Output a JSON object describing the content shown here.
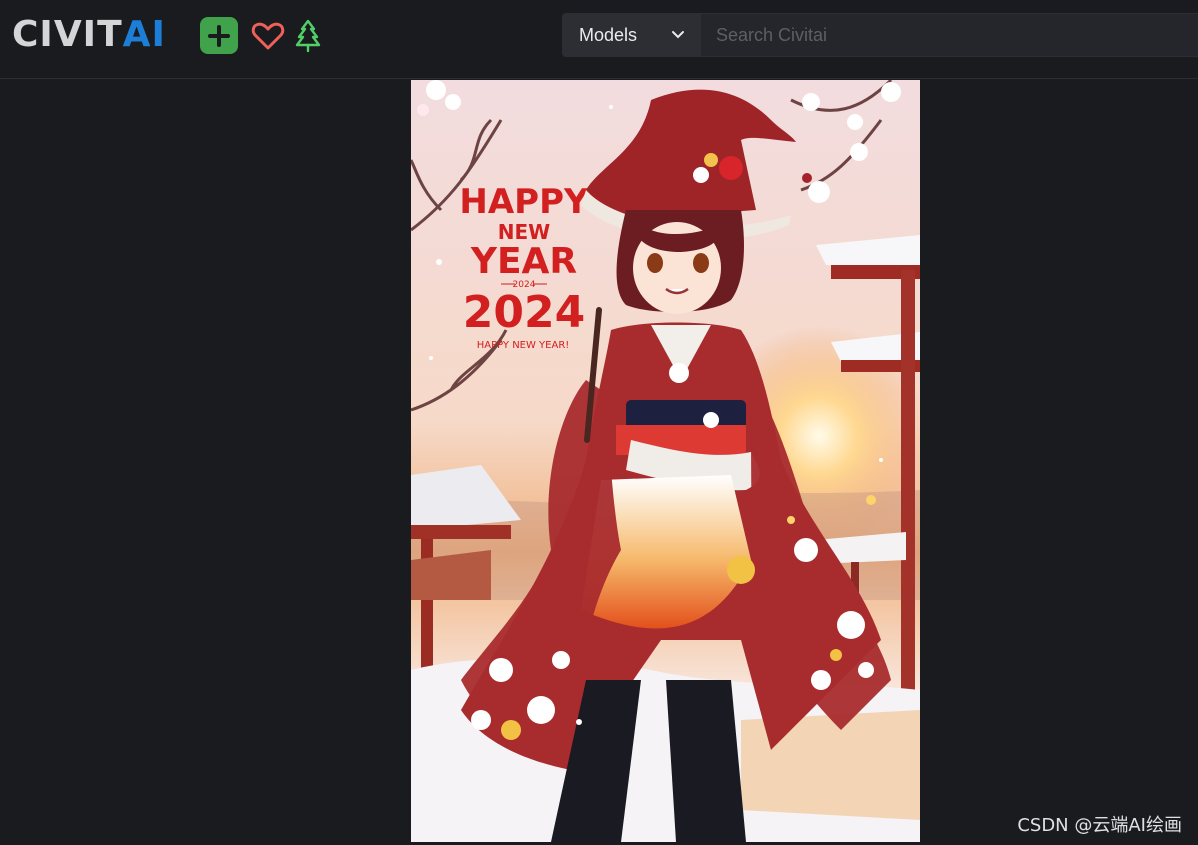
{
  "header": {
    "logo": {
      "part1": "CIVIT",
      "part2": "AI"
    },
    "create_button": "create",
    "icons": [
      "plus-icon",
      "heart-icon",
      "christmas-tree-icon"
    ],
    "search": {
      "type_select": "Models",
      "placeholder": "Search Civitai"
    }
  },
  "image": {
    "poster_lines": [
      "HAPPY",
      "NEW",
      "YEAR",
      "2024",
      "2024",
      "HAPPY NEW YEAR!"
    ]
  },
  "watermark": "CSDN @云端AI绘画",
  "colors": {
    "background": "#1a1b1e",
    "accent_blue": "#1c7ed6",
    "create_green": "#40a34b",
    "poster_red": "#d21f1f"
  }
}
